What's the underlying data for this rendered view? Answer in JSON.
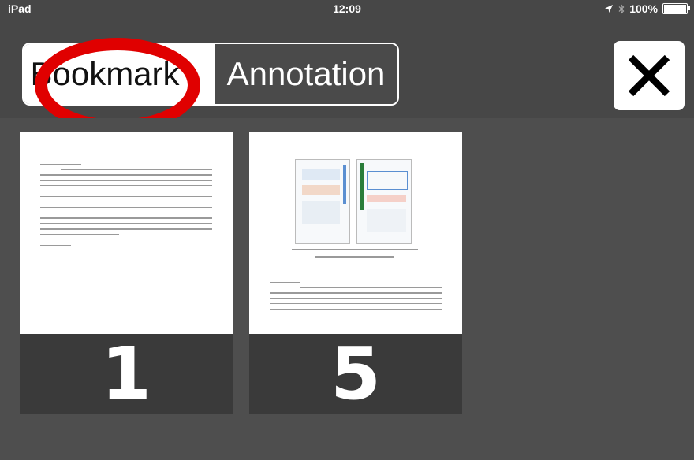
{
  "status_bar": {
    "carrier": "iPad",
    "time": "12:09",
    "battery": "100%",
    "battery_level": 1.0
  },
  "toolbar": {
    "segments": [
      {
        "label": "Bookmark",
        "selected": true
      },
      {
        "label": "Annotation",
        "selected": false
      }
    ],
    "close_icon": "close-x-icon"
  },
  "thumbnails": [
    {
      "page_number": "1"
    },
    {
      "page_number": "5"
    }
  ],
  "colors": {
    "background": "#4e4e4e",
    "toolbar": "#474747",
    "highlight": "#e00000"
  }
}
